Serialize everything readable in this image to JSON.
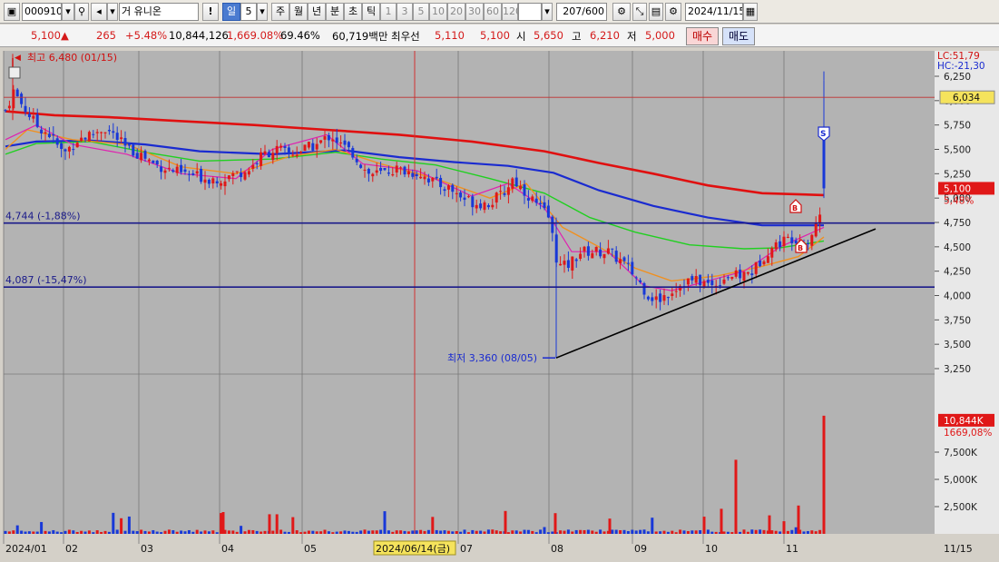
{
  "toolbar": {
    "code": "000910",
    "name": "거 유니온",
    "excl": "!",
    "period_active": "일",
    "period_num": "5",
    "periods": [
      "주",
      "월",
      "년",
      "분",
      "초",
      "틱"
    ],
    "ticks": [
      "1",
      "3",
      "5",
      "10",
      "20",
      "30",
      "60",
      "120"
    ],
    "count": "207/600",
    "date": "2024/11/15"
  },
  "quote": {
    "price": "5,100",
    "arrow": "▲",
    "change": "265",
    "change_pct": "+5.48%",
    "volume": "10,844,126",
    "volume_pct": "1,669.08%",
    "ratio": "69.46%",
    "amount": "60,719백만",
    "best_label": "최우선",
    "best_ask": "5,110",
    "best_bid": "5,100",
    "open_label": "시",
    "open": "5,650",
    "high_label": "고",
    "high": "6,210",
    "low_label": "저",
    "low": "5,000",
    "buy": "매수",
    "sell": "매도"
  },
  "chart": {
    "lc": "LC:51,79",
    "hc": "HC:-21,30",
    "crosshair_value": "6,034",
    "price_tag": "5,100",
    "price_pct": "5,48%",
    "vol_tag": "10,844K",
    "vol_pct": "1669,08%",
    "high_marker": "최고 6,480 (01/15)",
    "low_marker": "최저 3,360 (08/05)",
    "line1_label": "4,744 (-1,88%)",
    "line2_label": "4,087 (-15,47%)",
    "selected_date": "2024/06/14(금)",
    "signal_s": "S",
    "signal_b": "B",
    "price_ticks": [
      "6,250",
      "6,000",
      "5,750",
      "5,500",
      "5,250",
      "5,000",
      "4,750",
      "4,500",
      "4,250",
      "4,000",
      "3,750",
      "3,500",
      "3,250"
    ],
    "vol_ticks": [
      "7,500K",
      "5,000K",
      "2,500K"
    ],
    "x_labels": [
      "2024/01",
      "02",
      "03",
      "04",
      "05",
      "07",
      "08",
      "09",
      "10",
      "11",
      "11/15"
    ]
  }
}
